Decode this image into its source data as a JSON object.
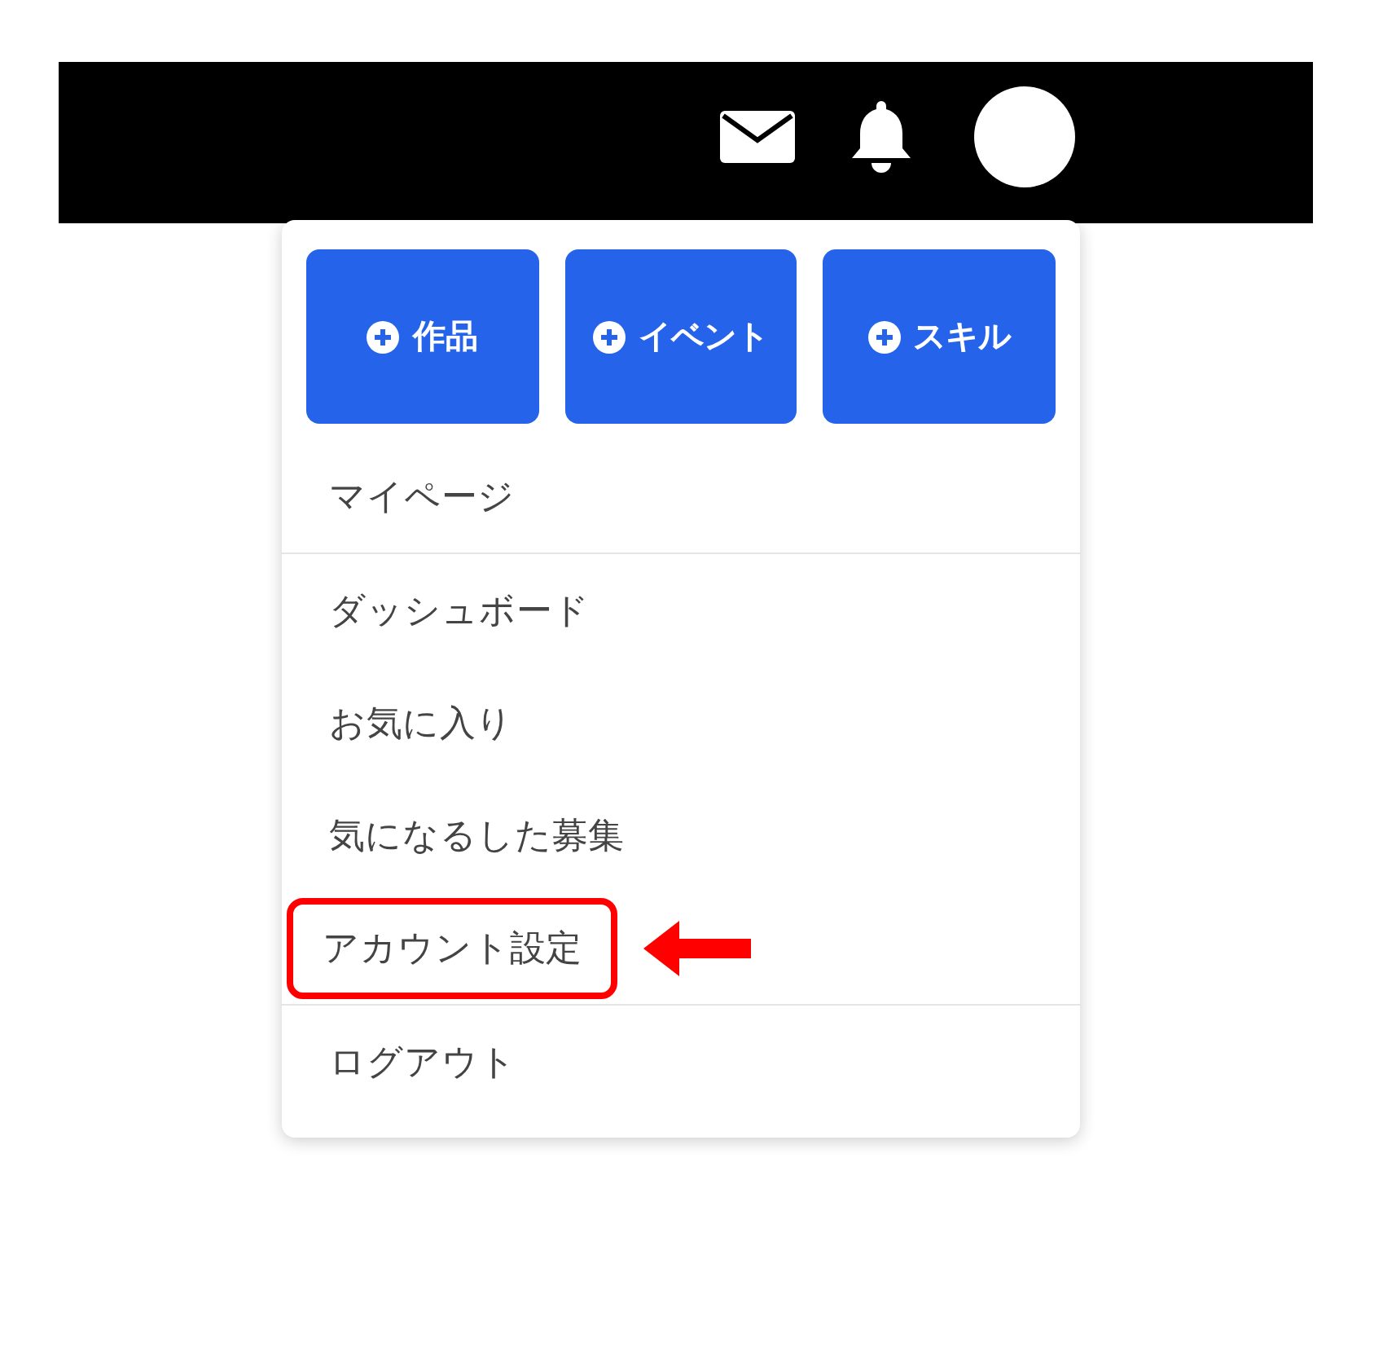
{
  "dropdown": {
    "create_buttons": [
      {
        "label": "作品"
      },
      {
        "label": "イベント"
      },
      {
        "label": "スキル"
      }
    ],
    "sections": [
      [
        {
          "label": "マイページ",
          "highlighted": false
        }
      ],
      [
        {
          "label": "ダッシュボード",
          "highlighted": false
        },
        {
          "label": "お気に入り",
          "highlighted": false
        },
        {
          "label": "気になるした募集",
          "highlighted": false
        },
        {
          "label": "アカウント設定",
          "highlighted": true
        }
      ],
      [
        {
          "label": "ログアウト",
          "highlighted": false
        }
      ]
    ]
  }
}
